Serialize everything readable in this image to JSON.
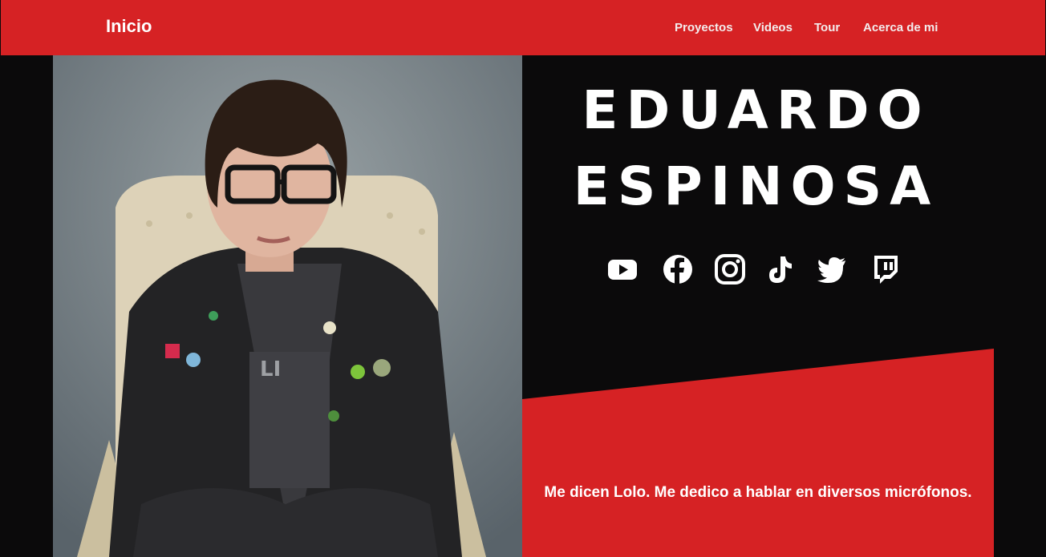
{
  "nav": {
    "brand": "Inicio",
    "links": [
      "Proyectos",
      "Videos",
      "Tour",
      "Acerca de mi"
    ]
  },
  "hero": {
    "first_name": "EDUARDO",
    "last_name": "ESPINOSA",
    "tagline": "Me dicen Lolo. Me dedico a hablar en diversos micrófonos.",
    "socials": [
      {
        "icon": "youtube-icon"
      },
      {
        "icon": "facebook-icon"
      },
      {
        "icon": "instagram-icon"
      },
      {
        "icon": "tiktok-icon"
      },
      {
        "icon": "twitter-icon"
      },
      {
        "icon": "twitch-icon"
      }
    ]
  },
  "colors": {
    "brand_red": "#d62224",
    "background": "#0b0a0b",
    "text": "#ffffff"
  }
}
